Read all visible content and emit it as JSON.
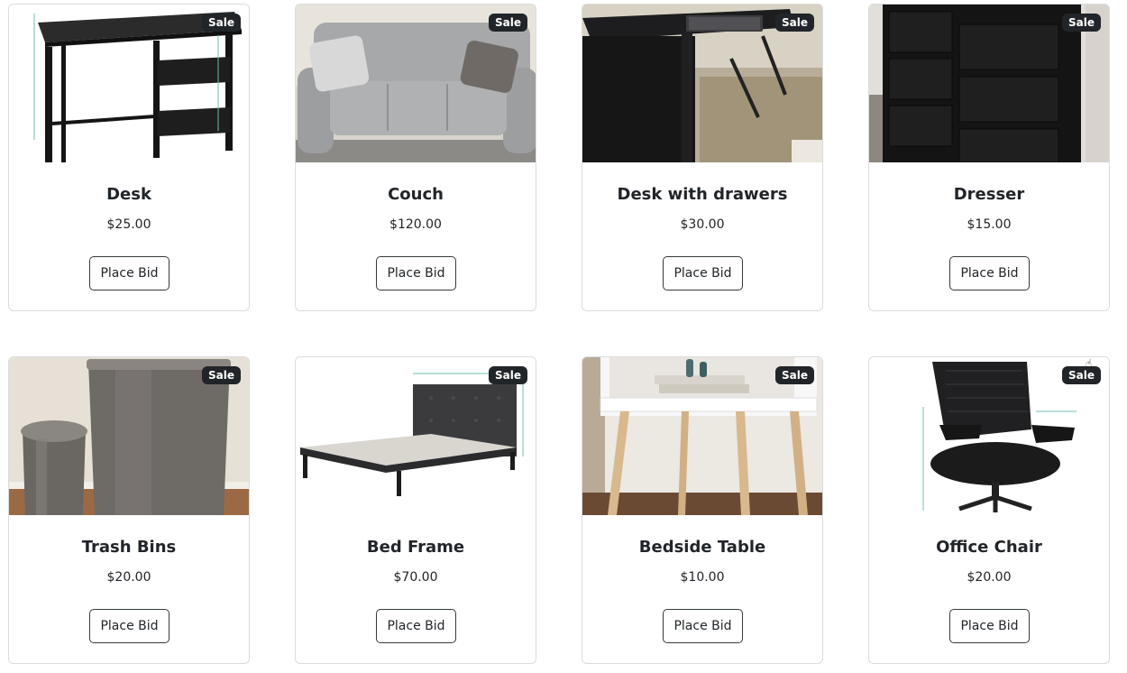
{
  "listings": [
    {
      "title": "Desk",
      "price": "$25.00",
      "badge": "Sale",
      "button": "Place Bid",
      "image": "black-desk-with-shelves-photo"
    },
    {
      "title": "Couch",
      "price": "$120.00",
      "badge": "Sale",
      "button": "Place Bid",
      "image": "grey-sofa-photo"
    },
    {
      "title": "Desk with drawers",
      "price": "$30.00",
      "badge": "Sale",
      "button": "Place Bid",
      "image": "black-desk-with-keyboard-photo"
    },
    {
      "title": "Dresser",
      "price": "$15.00",
      "badge": "Sale",
      "button": "Place Bid",
      "image": "black-fabric-dresser-photo"
    },
    {
      "title": "Trash Bins",
      "price": "$20.00",
      "badge": "Sale",
      "button": "Place Bid",
      "image": "steel-trash-bins-photo"
    },
    {
      "title": "Bed Frame",
      "price": "$70.00",
      "badge": "Sale",
      "button": "Place Bid",
      "image": "upholstered-bed-frame-photo"
    },
    {
      "title": "Bedside Table",
      "price": "$10.00",
      "badge": "Sale",
      "button": "Place Bid",
      "image": "white-wood-nightstand-photo"
    },
    {
      "title": "Office Chair",
      "price": "$20.00",
      "badge": "Sale",
      "button": "Place Bid",
      "image": "mesh-office-chair-photo"
    }
  ],
  "colors": {
    "badge_bg": "#212529",
    "border": "#dcdcdc",
    "button_border": "#343a40"
  }
}
